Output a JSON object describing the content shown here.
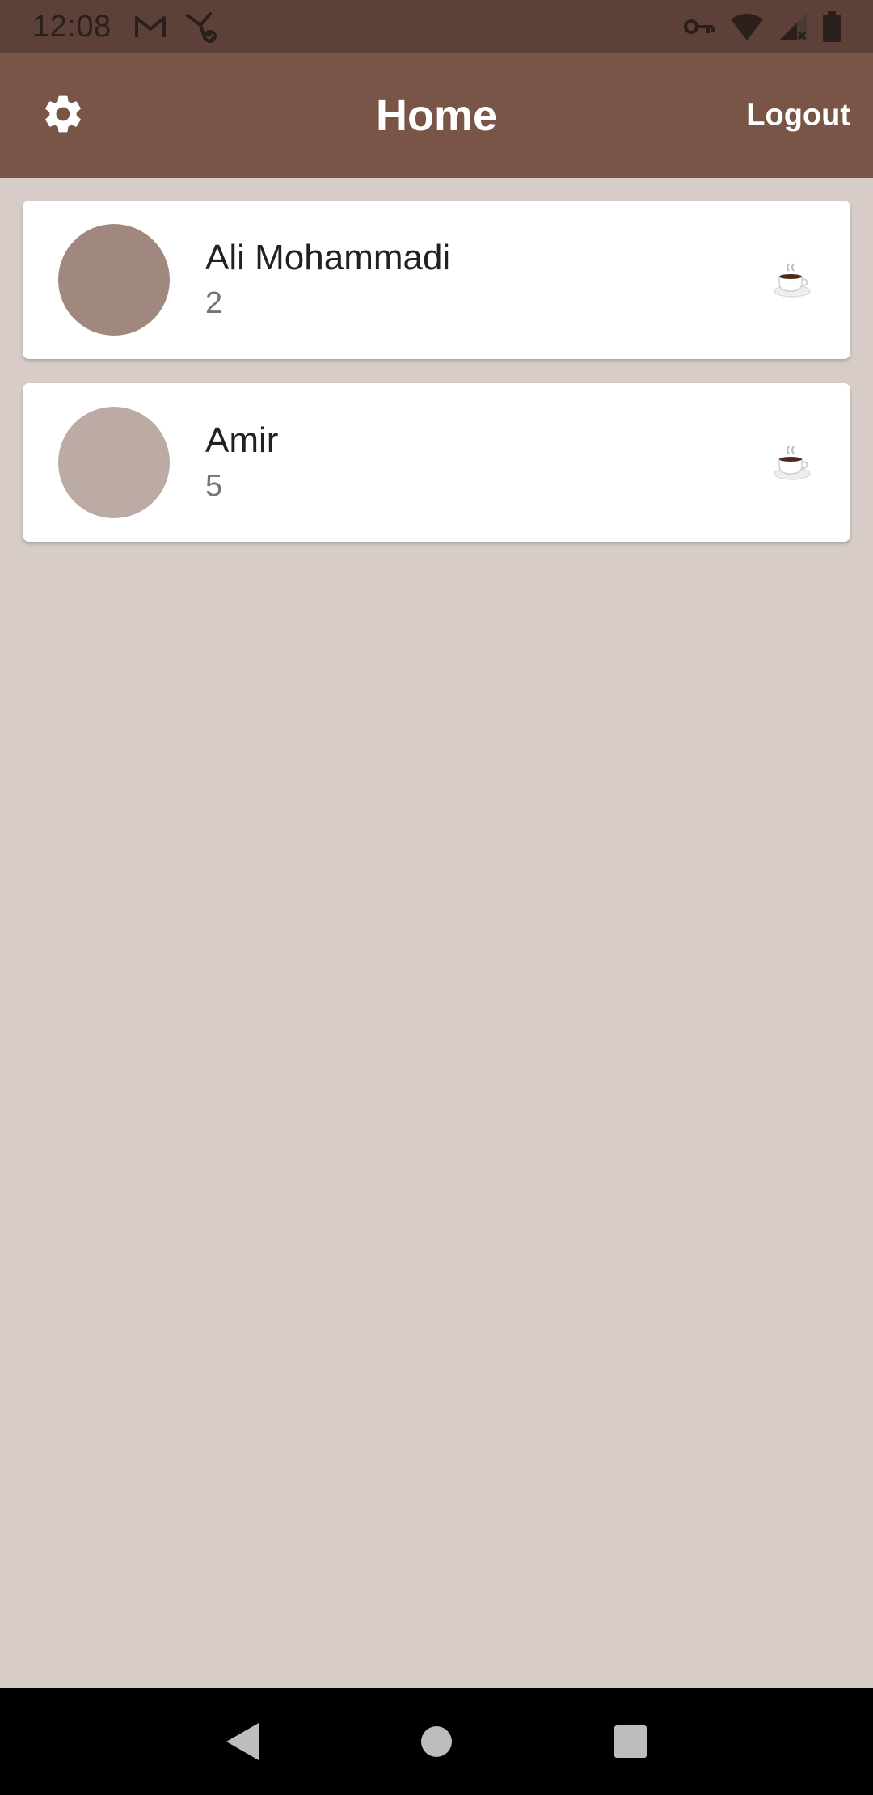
{
  "status_bar": {
    "time": "12:08",
    "left_icons": [
      "gmail-icon",
      "network-check-icon"
    ],
    "right_icons": [
      "vpn-key-icon",
      "wifi-icon",
      "signal-icon",
      "battery-icon"
    ]
  },
  "app_bar": {
    "title": "Home",
    "settings_icon": "gear-icon",
    "logout_label": "Logout"
  },
  "contacts": [
    {
      "name": "Ali Mohammadi",
      "count": "2",
      "avatar_color": "#a1887f",
      "action_icon": "coffee-cup-icon"
    },
    {
      "name": "Amir",
      "count": "5",
      "avatar_color": "#bcaaa4",
      "action_icon": "coffee-cup-icon"
    }
  ],
  "nav_bar": {
    "buttons": [
      "back-icon",
      "home-icon",
      "recents-icon"
    ]
  },
  "colors": {
    "status_bar": "#5d4037",
    "app_bar": "#795548",
    "background": "#d7ccc8"
  }
}
